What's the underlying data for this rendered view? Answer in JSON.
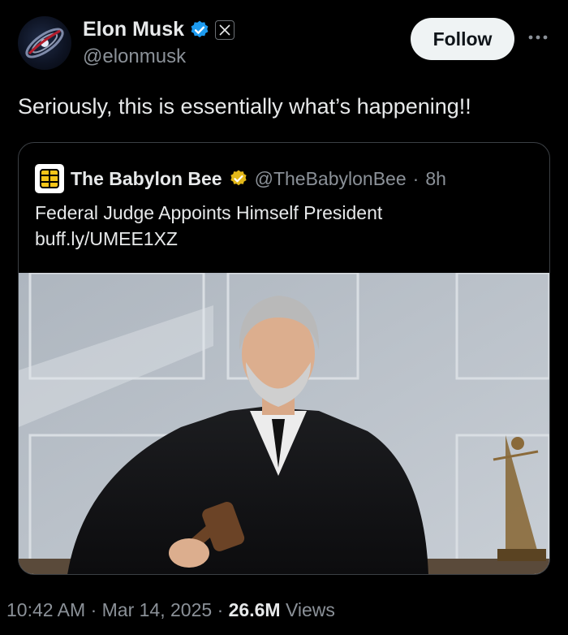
{
  "author": {
    "name": "Elon Musk",
    "handle": "@elonmusk",
    "avatar_icon": "galaxy-avatar-icon",
    "verified_color": "#1d9bf0"
  },
  "follow_label": "Follow",
  "tweet_text": "Seriously, this is essentially what’s happening!!",
  "quote": {
    "name": "The Babylon Bee",
    "handle": "@TheBabylonBee",
    "separator": "·",
    "time": "8h",
    "headline": "Federal Judge Appoints Himself President",
    "link": "buff.ly/UMEE1XZ",
    "verified_color": "#e2b719",
    "image_icon": "judge-with-gavel-photo"
  },
  "footer": {
    "time": "10:42 AM",
    "sep1": "·",
    "date": "Mar 14, 2025",
    "sep2": "·",
    "views_count": "26.6M",
    "views_label": "Views"
  }
}
